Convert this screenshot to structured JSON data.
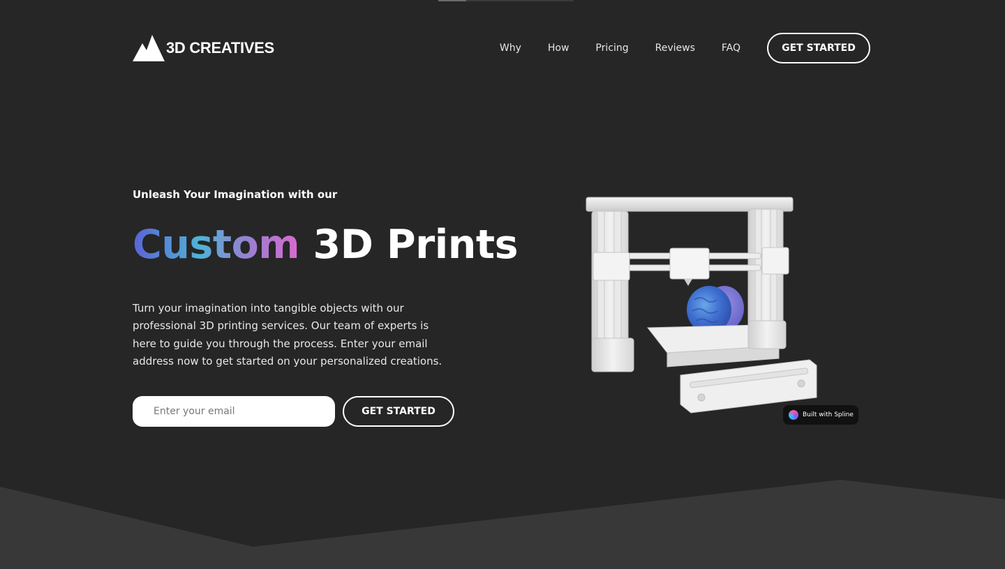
{
  "brand": {
    "name": "3D CREATIVES",
    "logo_icon": "mountain-logo-icon"
  },
  "nav": {
    "links": [
      {
        "label": "Why"
      },
      {
        "label": "How"
      },
      {
        "label": "Pricing"
      },
      {
        "label": "Reviews"
      },
      {
        "label": "FAQ"
      }
    ],
    "cta_label": "GET STARTED"
  },
  "hero": {
    "eyebrow": "Unleash Your Imagination with our",
    "headline_gradient": "Custom",
    "headline_rest": "3D Prints",
    "description": "Turn your imagination into tangible objects with our professional 3D printing services. Our team of experts is here to guide you through the process. Enter your email address now to get started on your personalized creations.",
    "email_placeholder": "Enter your email",
    "cta_label": "GET STARTED"
  },
  "viewer": {
    "badge_label": "Built with Spline"
  },
  "colors": {
    "background": "#262626",
    "bottom_band": "#383838",
    "accent_gradient": [
      "#5b63d6",
      "#4fb3d6",
      "#9a7fd0",
      "#d86ad0"
    ]
  }
}
